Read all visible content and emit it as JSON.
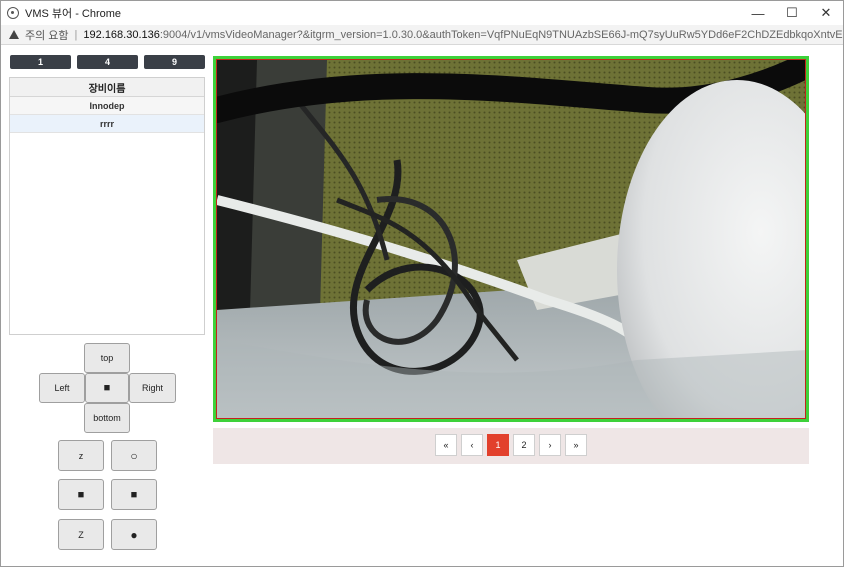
{
  "window": {
    "title": "VMS 뷰어 - Chrome",
    "controls": {
      "minimize": "—",
      "maximize": "☐",
      "close": "✕"
    }
  },
  "address": {
    "security_label": "주의 요함",
    "host": "192.168.30.136",
    "path": ":9004/v1/vmsVideoManager?&itgrm_version=1.0.30.0&authToken=VqfPNuEqN9TNUAzbSE66J-mQ7syUuRw5YDd6eF2ChDZEdbkqoXntvE..."
  },
  "layout_buttons": [
    "1",
    "4",
    "9"
  ],
  "device_list": {
    "header": "장비이름",
    "rows": [
      "Innodep",
      "rrrr"
    ]
  },
  "ptz": {
    "top": "top",
    "left": "Left",
    "center": "■",
    "right": "Right",
    "bottom": "bottom"
  },
  "extra_controls": {
    "z_small": "z",
    "circle_open": "○",
    "square_a": "■",
    "square_b": "■",
    "z_large": "Z",
    "circle_filled": "●"
  },
  "pagination": {
    "first": "«",
    "prev": "‹",
    "pages": [
      "1",
      "2"
    ],
    "active_page": "1",
    "next": "›",
    "last": "»"
  },
  "colors": {
    "video_border": "#3ed13a",
    "video_inner_border": "#c4231d",
    "active_page": "#e2402c",
    "layout_button": "#3a3f47"
  }
}
